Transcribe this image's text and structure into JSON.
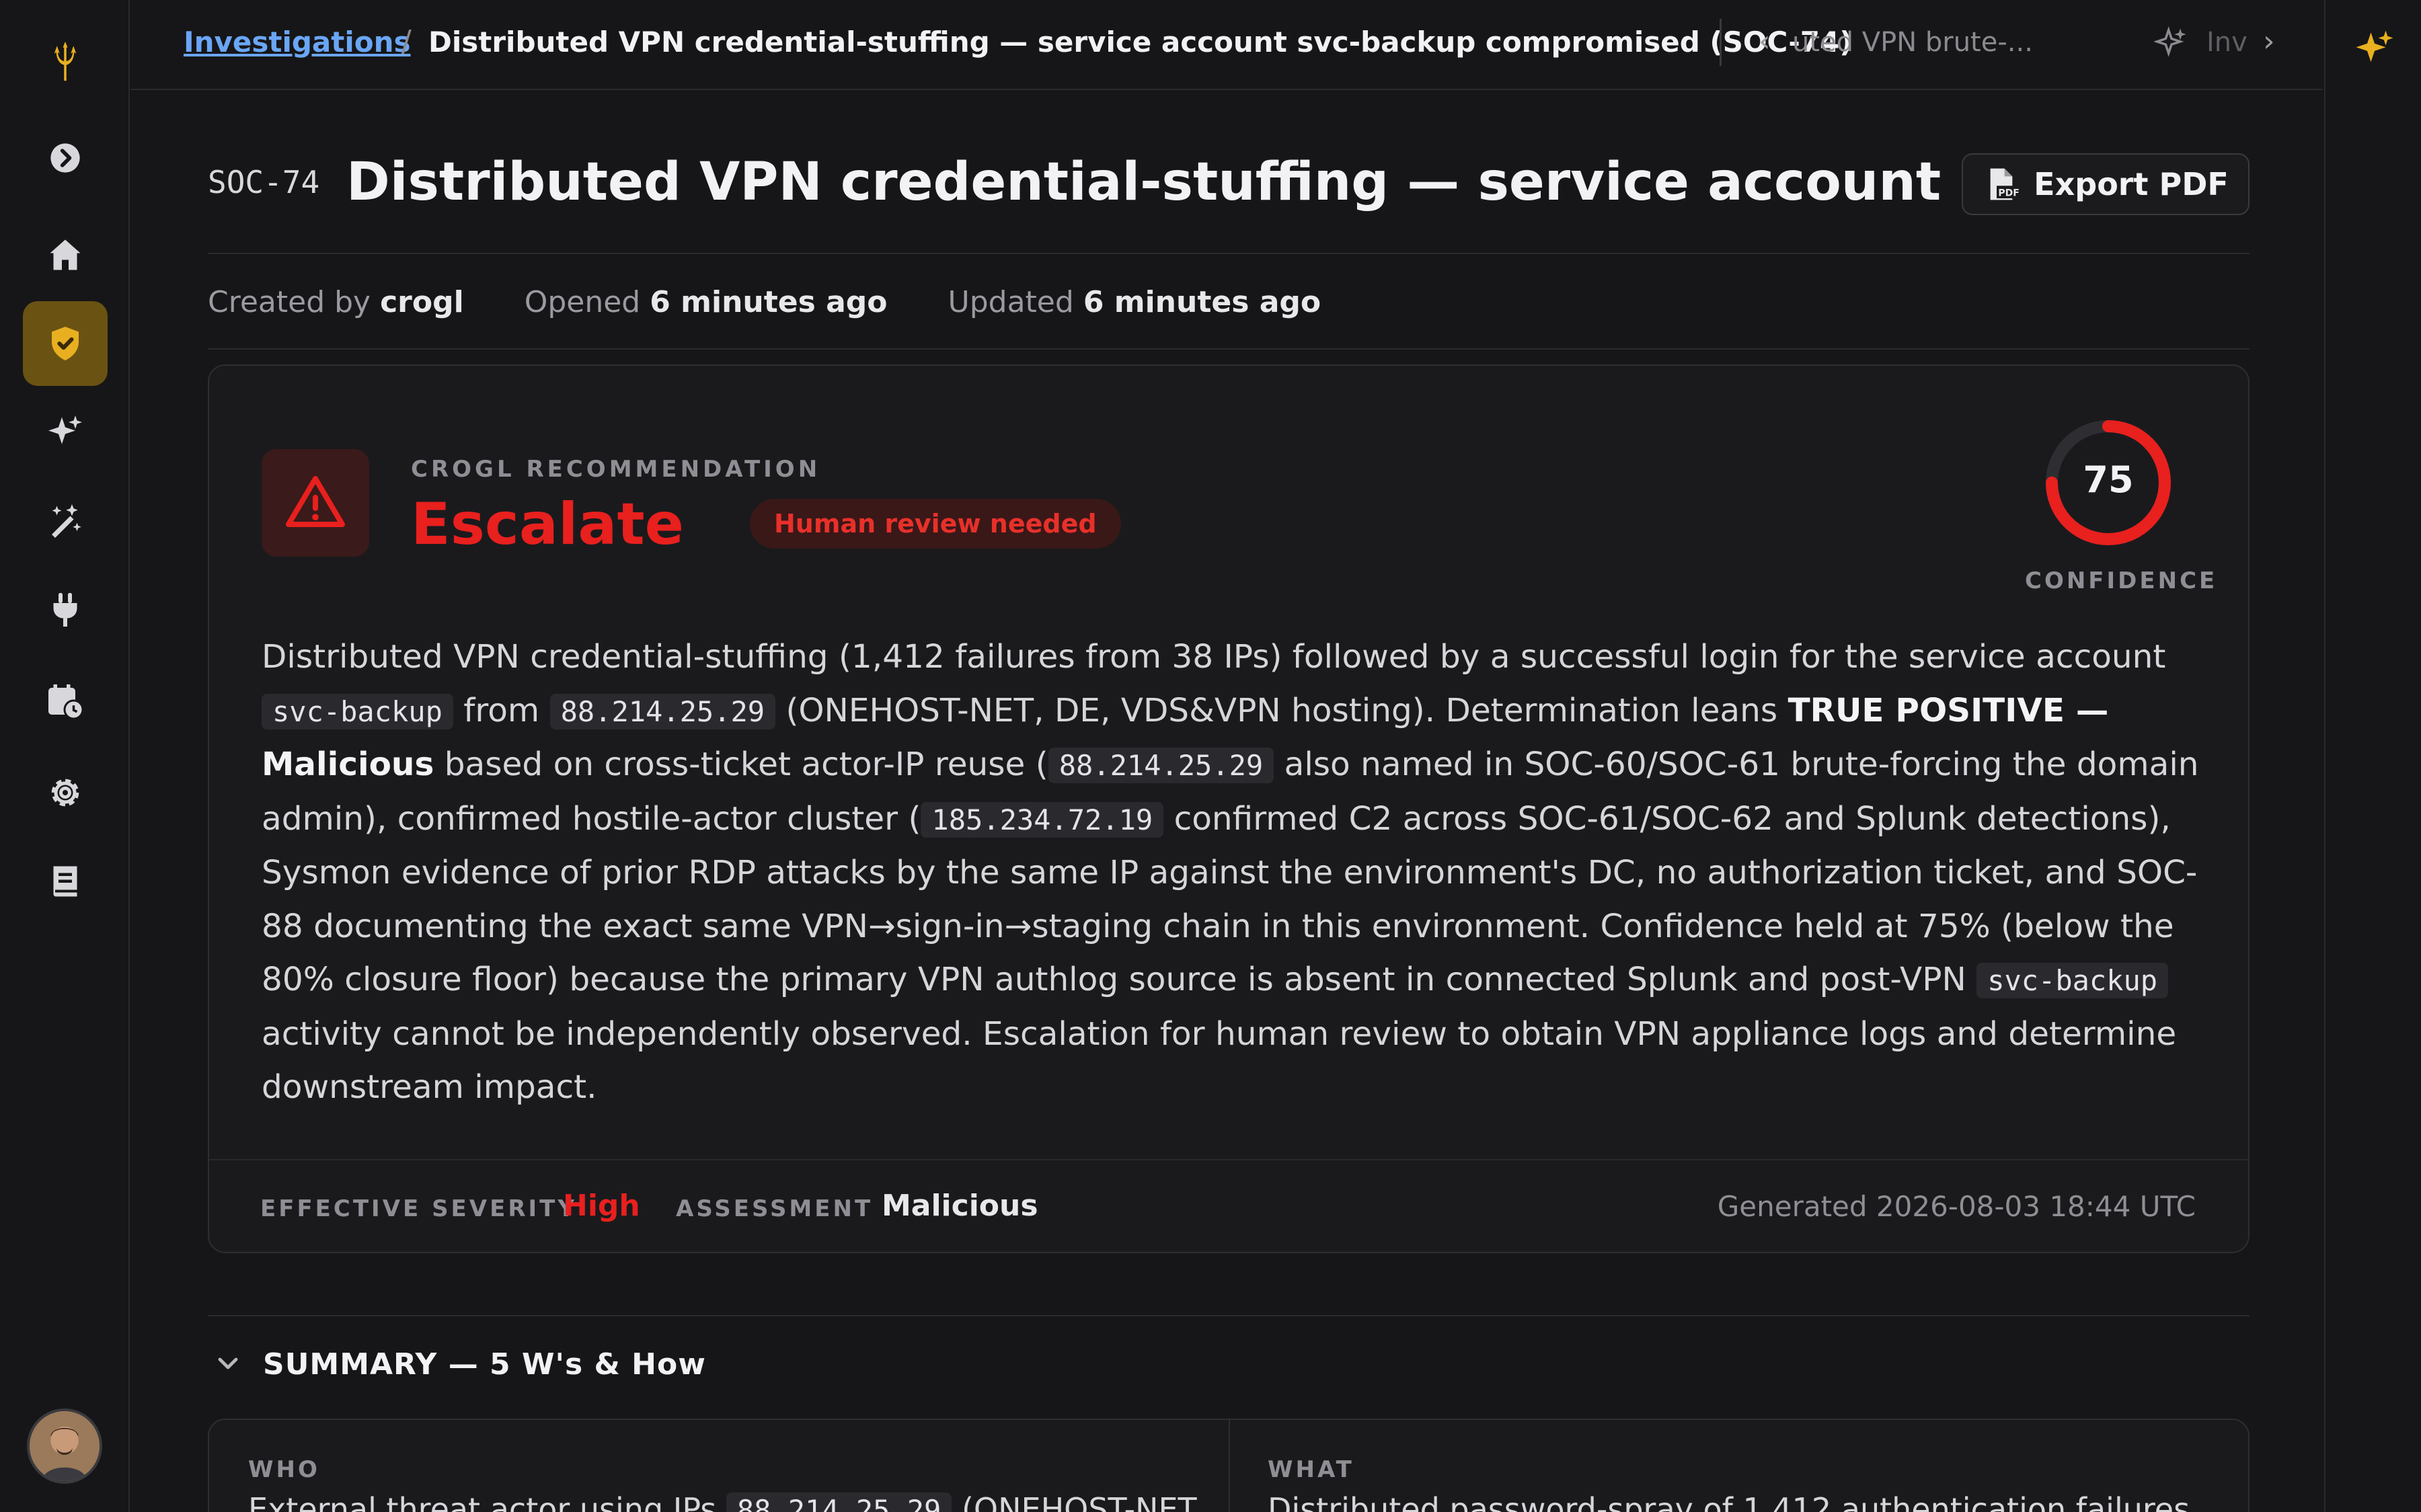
{
  "sidebar": {
    "items": [
      "logo",
      "expand",
      "home",
      "investigations",
      "ai-agents",
      "automations",
      "integrations",
      "schedules",
      "settings",
      "docs"
    ]
  },
  "breadcrumb": {
    "link": "Investigations",
    "separator": "/",
    "current": "Distributed VPN credential-stuffing — service account svc-backup compromised (SOC-74)"
  },
  "nav": {
    "prev_label": "uted VPN brute-...",
    "next_label": "Inv"
  },
  "header": {
    "case_id": "SOC-74",
    "title": "Distributed VPN credential-stuffing — service account ...",
    "export_label": "Export PDF"
  },
  "meta": {
    "created_prefix": "Created by",
    "created_by": "crogl",
    "opened_prefix": "Opened",
    "opened": "6 minutes ago",
    "updated_prefix": "Updated",
    "updated": "6 minutes ago"
  },
  "recommendation": {
    "label": "CROGL RECOMMENDATION",
    "verdict": "Escalate",
    "badge": "Human review needed",
    "confidence": 75,
    "confidence_label": "CONFIDENCE",
    "text": {
      "p1": "Distributed VPN credential-stuffing (1,412 failures from 38 IPs) followed by a successful login for the service account",
      "c1": "svc-backup",
      "p2": "from",
      "c2": "88.214.25.29",
      "p3": "(ONEHOST-NET, DE, VDS&VPN hosting). Determination leans",
      "b1": "TRUE POSITIVE — Malicious",
      "p4": "based on cross-ticket actor-IP reuse (",
      "c3": "88.214.25.29",
      "p5": "also named in SOC-60/SOC-61 brute-forcing the domain admin), confirmed hostile-actor cluster (",
      "c4": "185.234.72.19",
      "p6": "confirmed C2 across SOC-61/SOC-62 and Splunk detections), Sysmon evidence of prior RDP attacks by the same IP against the environment's DC, no authorization ticket, and SOC-88 documenting the exact same VPN→sign-in→staging chain in this environment. Confidence held at 75% (below the 80% closure floor) because the primary VPN authlog source is absent in connected Splunk and post-VPN",
      "c5": "svc-backup",
      "p7": "activity cannot be independently observed. Escalation for human review to obtain VPN appliance logs and determine downstream impact."
    },
    "footer": {
      "severity_label": "EFFECTIVE SEVERITY",
      "severity": "High",
      "assessment_label": "ASSESSMENT",
      "assessment": "Malicious",
      "generated": "Generated 2026-08-03 18:44 UTC"
    }
  },
  "summary": {
    "title": "SUMMARY — 5 W's & How",
    "who_label": "WHO",
    "who_text_pre": "External threat actor using IPs",
    "who_code": "88.214.25.29",
    "who_text_post": "(ONEHOST-NET",
    "what_label": "WHAT",
    "what_text": "Distributed password-spray of 1,412 authentication failures"
  },
  "colors": {
    "accent_gold": "#e8b020",
    "danger_red": "#e8201e",
    "link_blue": "#6aa6f6"
  }
}
